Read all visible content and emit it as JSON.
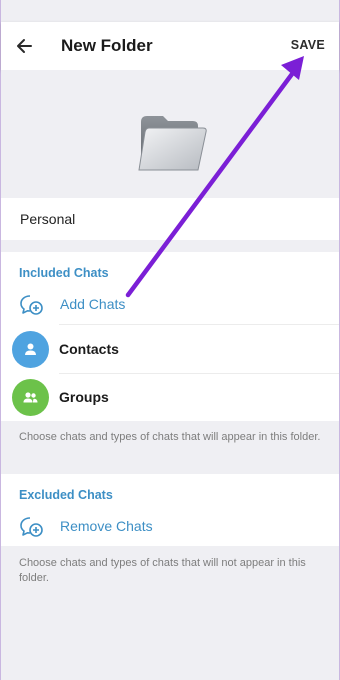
{
  "header": {
    "title": "New Folder",
    "save_label": "SAVE"
  },
  "folder": {
    "name": "Personal"
  },
  "included": {
    "header": "Included Chats",
    "add_label": "Add Chats",
    "items": [
      {
        "label": "Contacts",
        "color": "#4fa3e0",
        "icon": "person-icon"
      },
      {
        "label": "Groups",
        "color": "#6cc24a",
        "icon": "group-icon"
      }
    ],
    "hint": "Choose chats and types of chats that will appear in this folder."
  },
  "excluded": {
    "header": "Excluded Chats",
    "remove_label": "Remove Chats",
    "hint": "Choose chats and types of chats that will not appear in this folder."
  },
  "colors": {
    "accent": "#3d8fc5",
    "annotation_arrow": "#7b1fd6"
  }
}
